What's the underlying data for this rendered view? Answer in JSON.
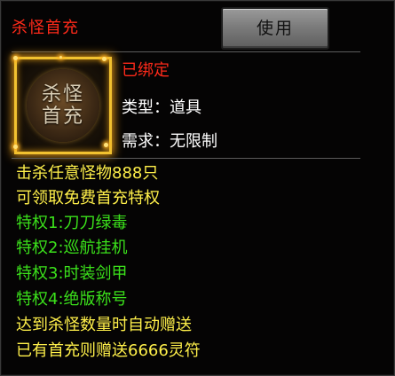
{
  "item": {
    "name": "杀怪首充",
    "icon_text": [
      "杀怪",
      "首充"
    ],
    "icon_name": "kill-monster-first-recharge-icon"
  },
  "actions": {
    "use_label": "使用"
  },
  "status": {
    "bound": "已绑定"
  },
  "attributes": {
    "type_label": "类型：",
    "type_value": "道具",
    "requirement_label": "需求：",
    "requirement_value": "无限制"
  },
  "description": [
    {
      "text": "击杀任意怪物888只",
      "color": "yellow"
    },
    {
      "text": "可领取免费首充特权",
      "color": "yellow"
    },
    {
      "text": "特权1:刀刀绿毒",
      "color": "green"
    },
    {
      "text": "特权2:巡航挂机",
      "color": "green"
    },
    {
      "text": "特权3:时装剑甲",
      "color": "green"
    },
    {
      "text": "特权4:绝版称号",
      "color": "green"
    },
    {
      "text": "达到杀怪数量时自动赠送",
      "color": "yellow"
    },
    {
      "text": "已有首充则赠送6666灵符",
      "color": "yellow"
    }
  ],
  "colors": {
    "title_red": "#ff2a1a",
    "desc_yellow": "#fff04a",
    "desc_green": "#3be11b",
    "frame_gold": "#f2c230"
  }
}
